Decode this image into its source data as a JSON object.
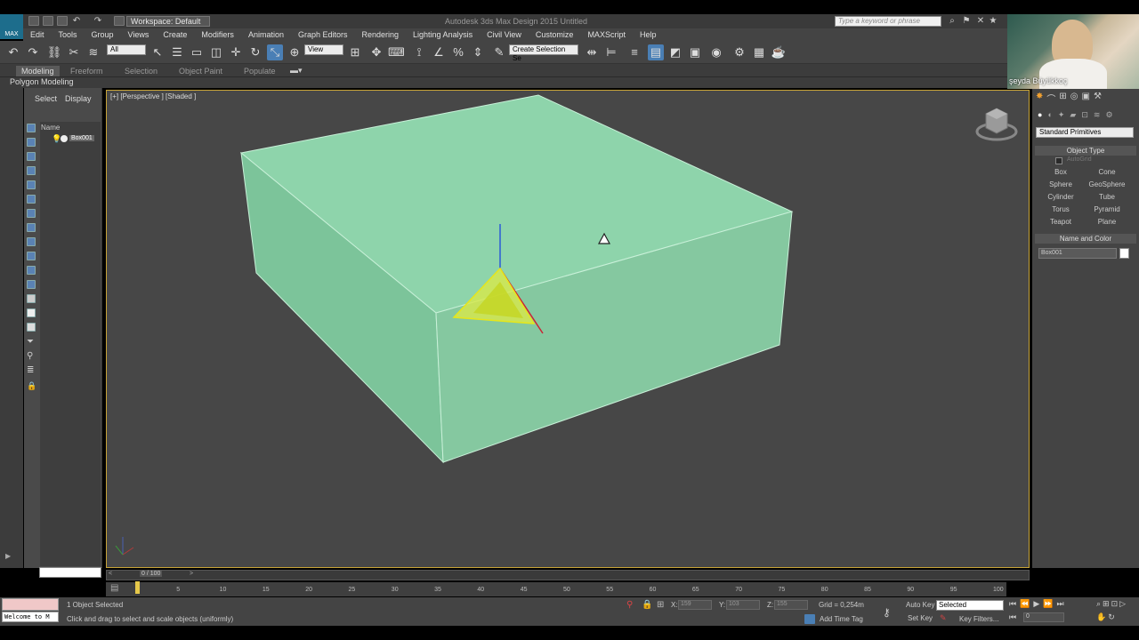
{
  "titlebar": {
    "workspace": "Workspace: Default",
    "app_title": "Autodesk 3ds Max Design 2015    Untitled",
    "search_placeholder": "Type a keyword or phrase",
    "logo_text": "MAX"
  },
  "menu": [
    "Edit",
    "Tools",
    "Group",
    "Views",
    "Create",
    "Modifiers",
    "Animation",
    "Graph Editors",
    "Rendering",
    "Lighting Analysis",
    "Civil View",
    "Customize",
    "MAXScript",
    "Help"
  ],
  "toolbar": {
    "selection_filter": "All",
    "ref_coord": "View",
    "named_selection": "Create Selection Se"
  },
  "ribbon": {
    "tabs": [
      "Modeling",
      "Freeform",
      "Selection",
      "Object Paint",
      "Populate"
    ],
    "active_tab": "Modeling",
    "panel": "Polygon Modeling"
  },
  "scene_explorer": {
    "tabs": [
      "Select",
      "Display"
    ],
    "column": "Name",
    "objects": [
      "Box001"
    ]
  },
  "viewport": {
    "label": "[+] [Perspective ] [Shaded ]",
    "box_color": "#8ed4ab",
    "selection_color": "#c8a437"
  },
  "command_panel": {
    "category": "Standard Primitives",
    "object_type_title": "Object Type",
    "autogrid": "AutoGrid",
    "primitives": [
      "Box",
      "Cone",
      "Sphere",
      "GeoSphere",
      "Cylinder",
      "Tube",
      "Torus",
      "Pyramid",
      "Teapot",
      "Plane"
    ],
    "name_color_title": "Name and Color",
    "object_name": "Box001"
  },
  "timeline": {
    "frame": "0 / 100",
    "ticks": [
      "0",
      "5",
      "10",
      "15",
      "20",
      "25",
      "30",
      "35",
      "40",
      "45",
      "50",
      "55",
      "60",
      "65",
      "70",
      "75",
      "80",
      "85",
      "90",
      "95",
      "100"
    ]
  },
  "status": {
    "maxscript": "Welcome to M",
    "selected": "1 Object Selected",
    "prompt": "Click and drag to select and scale objects (uniformly)",
    "x_label": "X:",
    "x_value": "159",
    "y_label": "Y:",
    "y_value": "103",
    "z_label": "Z:",
    "z_value": "155",
    "grid": "Grid = 0,254m",
    "add_time_tag": "Add Time Tag",
    "auto_key": "Auto Key",
    "set_key": "Set Key",
    "key_mode": "Selected",
    "key_filters": "Key Filters...",
    "frame_field": "0"
  },
  "webcam": {
    "name": "şeyda Büyükkoç"
  }
}
